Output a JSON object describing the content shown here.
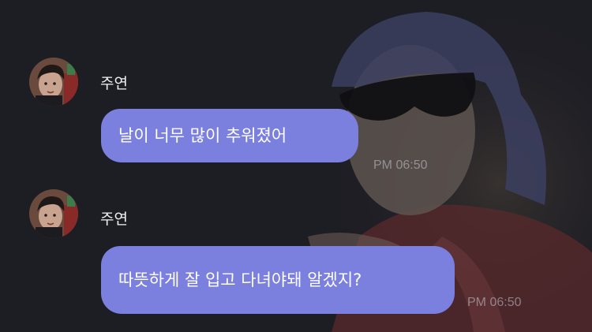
{
  "messages": [
    {
      "sender": "주연",
      "avatar_icon": "profile-photo-icon",
      "text": "날이 너무 많이 추워졌어",
      "time": "PM 06:50"
    },
    {
      "sender": "주연",
      "avatar_icon": "profile-photo-icon",
      "text": "따뜻하게 잘 입고 다녀야돼 알겠지?",
      "time": "PM 06:50"
    }
  ],
  "colors": {
    "background": "#1d1d24",
    "bubble": "#7b7fde",
    "text": "#ffffff",
    "timestamp": "#8f8f98"
  }
}
